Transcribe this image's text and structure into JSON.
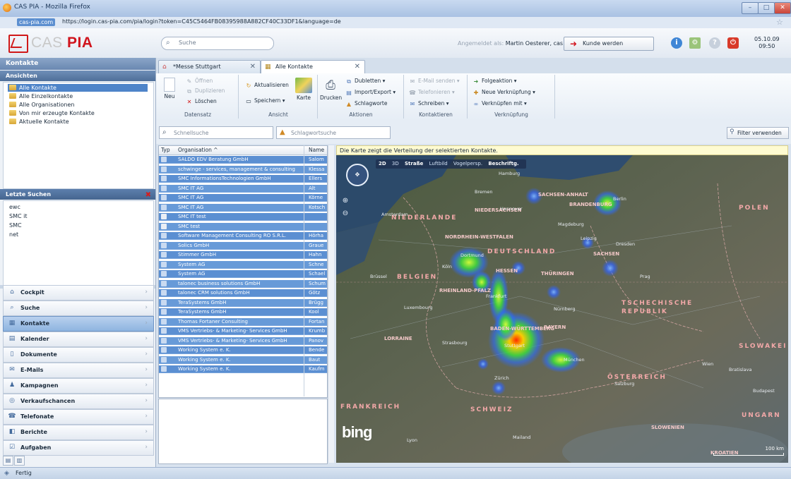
{
  "browser": {
    "title": "CAS PIA - Mozilla Firefox",
    "site": "cas-pia.com",
    "url": "https://login.cas-pia.com/pia/login?token=C45C5464FB08395988A882CF40C33DF1&language=de"
  },
  "header": {
    "logo_cas": "CAS",
    "logo_pia": "PIA",
    "search_placeholder": "Suche",
    "logged_prefix": "Angemeldet als:",
    "user": "Martin Oesterer, cas",
    "kunde_button": "Kunde werden",
    "date": "05.10.09",
    "time": "09:50"
  },
  "sidebar": {
    "title": "Kontakte",
    "views_title": "Ansichten",
    "views": [
      {
        "label": "Alle Kontakte"
      },
      {
        "label": "Alle Einzelkontakte"
      },
      {
        "label": "Alle Organisationen"
      },
      {
        "label": "Von mir erzeugte Kontakte"
      },
      {
        "label": "Aktuelle Kontakte"
      }
    ],
    "recent_title": "Letzte Suchen",
    "recent": [
      "ewc",
      "SMC it",
      "SMC",
      "net"
    ],
    "modules": [
      {
        "label": "Cockpit",
        "icon": "home-icon"
      },
      {
        "label": "Suche",
        "icon": "search-icon"
      },
      {
        "label": "Kontakte",
        "icon": "contacts-icon"
      },
      {
        "label": "Kalender",
        "icon": "calendar-icon"
      },
      {
        "label": "Dokumente",
        "icon": "document-icon"
      },
      {
        "label": "E-Mails",
        "icon": "email-icon"
      },
      {
        "label": "Kampagnen",
        "icon": "campaign-icon"
      },
      {
        "label": "Verkaufschancen",
        "icon": "sales-icon"
      },
      {
        "label": "Telefonate",
        "icon": "phone-icon"
      },
      {
        "label": "Berichte",
        "icon": "report-icon"
      },
      {
        "label": "Aufgaben",
        "icon": "task-icon"
      }
    ],
    "active_module": "Kontakte"
  },
  "tabs": [
    {
      "label": "*Messe Stuttgart"
    },
    {
      "label": "Alle Kontakte"
    }
  ],
  "ribbon": {
    "datensatz": {
      "label": "Datensatz",
      "neu": "Neu",
      "oeffnen": "Öffnen",
      "duplizieren": "Duplizieren",
      "loeschen": "Löschen"
    },
    "ansicht": {
      "label": "Ansicht",
      "aktualisieren": "Aktualisieren",
      "speichern": "Speichern",
      "karte": "Karte"
    },
    "aktionen": {
      "label": "Aktionen",
      "drucken": "Drucken",
      "dubletten": "Dubletten",
      "import_export": "Import/Export",
      "schlagworte": "Schlagworte"
    },
    "kontaktieren": {
      "label": "Kontaktieren",
      "email": "E-Mail senden",
      "telefonieren": "Telefonieren",
      "schreiben": "Schreiben"
    },
    "verknuepfung": {
      "label": "Verknüpfung",
      "folgeaktion": "Folgeaktion",
      "neue": "Neue Verknüpfung",
      "verknuepfen": "Verknüpfen mit"
    }
  },
  "filter": {
    "schnellsuche": "Schnellsuche",
    "schlagwortsuche": "Schlagwortsuche",
    "filter_button": "Filter verwenden"
  },
  "grid": {
    "headers": {
      "typ": "Typ",
      "organisation": "Organisation ^",
      "name": "Name"
    },
    "rows": [
      {
        "org": "SALDO EDV Beratung GmbH",
        "name": "Salom"
      },
      {
        "org": "schwinge - services, management & consulting",
        "name": "Klessa"
      },
      {
        "org": "SMC InformationsTechnologien GmbH",
        "name": "Ellers"
      },
      {
        "org": "SMC IT AG",
        "name": "Alt"
      },
      {
        "org": "SMC IT AG",
        "name": "Körne"
      },
      {
        "org": "SMC IT AG",
        "name": "Kotsch"
      },
      {
        "org": "SMC IT test",
        "name": ""
      },
      {
        "org": "SMC test",
        "name": ""
      },
      {
        "org": "Software Management Consulting RO S.R.L.",
        "name": "Hörha"
      },
      {
        "org": "Solics GmbH",
        "name": "Graue"
      },
      {
        "org": "Stimmer GmbH",
        "name": "Hahn"
      },
      {
        "org": "System AG",
        "name": "Schne"
      },
      {
        "org": "System AG",
        "name": "Schael"
      },
      {
        "org": "talonec business solutions GmbH",
        "name": "Schum"
      },
      {
        "org": "talonec CRM solutions GmbH",
        "name": "Götz"
      },
      {
        "org": "TeraSystems GmbH",
        "name": "Brügg"
      },
      {
        "org": "TeraSystems GmbH",
        "name": "Kool"
      },
      {
        "org": "Thomas Fortaner Consulting",
        "name": "Fortan"
      },
      {
        "org": "VMS Vertriebs- & Marketing- Services GmbH",
        "name": "Krumb"
      },
      {
        "org": "VMS Vertriebs- & Marketing- Services GmbH",
        "name": "Panov"
      },
      {
        "org": "Working System e. K.",
        "name": "Bende"
      },
      {
        "org": "Working System e. K.",
        "name": "Baut"
      },
      {
        "org": "Working System e. K.",
        "name": "Kaufm"
      }
    ]
  },
  "map": {
    "hint": "Die Karte zeigt die Verteilung der selektierten Kontakte.",
    "toolbar": [
      "2D",
      "3D",
      "Straße",
      "Luftbild",
      "Vogelpersp.",
      "Beschriftg."
    ],
    "brand": "bing",
    "scale": "100 km",
    "labels": {
      "de": "DEUTSCHLAND",
      "nl": "NIEDERLANDE",
      "be": "BELGIEN",
      "fr": "FRANKREICH",
      "ch": "SCHWEIZ",
      "at": "ÖSTERREICH",
      "cz": "TSCHECHISCHE REPUBLIK",
      "pl": "POLEN",
      "sk": "SLOWAKEI",
      "ung": "UNGARN",
      "slo": "SLOWENIEN",
      "kro": "KROATIEN",
      "nrw": "NORDRHEIN-WESTFALEN",
      "nds": "NIEDERSACHSEN",
      "hessen": "HESSEN",
      "bayern": "BAYERN",
      "bw": "BADEN-WÜRTTEMBERG",
      "rlp": "RHEINLAND-PFALZ",
      "thu": "THÜRINGEN",
      "sachsen": "SACHSEN",
      "sa": "SACHSEN-ANHALT",
      "bb": "BRANDENBURG",
      "lorraine": "LORRAINE",
      "berlin": "Berlin",
      "hamburg": "Hamburg",
      "hannover": "Hannover",
      "frankfurt": "Frankfurt",
      "stuttgart": "Stuttgart",
      "muenchen": "München",
      "wien": "Wien",
      "prag": "Prag",
      "amsterdam": "Amsterdam",
      "brussel": "Brüssel",
      "dresden": "Dresden",
      "leipzig": "Leipzig",
      "nuernberg": "Nürnberg",
      "dortmund": "Dortmund",
      "koeln": "Köln",
      "bremen": "Bremen",
      "zuerich": "Zürich",
      "luxembourg": "Luxembourg",
      "salzburg": "Salzburg",
      "lyon": "Lyon",
      "strasbourg": "Strasbourg",
      "bratislava": "Bratislava",
      "budapest": "Budapest",
      "mailand": "Mailand",
      "magdeburg": "Magdeburg"
    }
  },
  "status": {
    "text": "Fertig"
  }
}
